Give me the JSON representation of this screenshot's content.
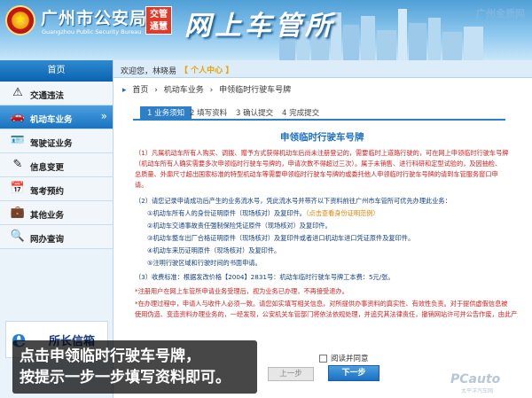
{
  "header": {
    "site_title": "广州市公安局",
    "site_subtitle": "Guangzhou Public Security Bureau",
    "badge": [
      "交管",
      "通慧"
    ],
    "portal_title": "网上车管所",
    "watermark": "广州金质网"
  },
  "topbar": {
    "welcome": "欢迎您，林晓易",
    "personal_center": "【 个人中心 】"
  },
  "sidebar": {
    "home": "首页",
    "items": [
      {
        "label": "交通违法",
        "icon": "warning-icon"
      },
      {
        "label": "机动车业务",
        "icon": "car-icon",
        "active": true
      },
      {
        "label": "驾驶证业务",
        "icon": "license-icon"
      },
      {
        "label": "信息变更",
        "icon": "edit-icon"
      },
      {
        "label": "驾考预约",
        "icon": "calendar-icon"
      },
      {
        "label": "其他业务",
        "icon": "briefcase-icon"
      },
      {
        "label": "网办查询",
        "icon": "search-icon"
      }
    ],
    "mayor_mail": "所长信箱",
    "mayor_e": "e"
  },
  "breadcrumb": [
    "首页",
    "机动车业务",
    "申领临时行驶车号牌"
  ],
  "steps": [
    "1 业务须知",
    "2 填写资料",
    "3 确认提交",
    "4 完成提交"
  ],
  "form_title": "申领临时行驶车号牌",
  "notice": {
    "line1": "（1）凡属机动车所有人购买、调拨、赠予方式获得机动车后尚未注册登记的，需要临时上道路行驶的，可在网上申领临时行驶车号牌",
    "line2": "（机动车所有人确实需要多次申领临时行驶车号牌的，申请次数不得超过三次）。属于未销售、进行科研和定型试验的，及因抽检、",
    "line3": "总质量、外廓尺寸超出国家标准的特型机动车等需要申领临时行驶车号牌的或委托他人申领临时行驶车号牌的请到车管服务窗口申",
    "line4": "请。",
    "line5": "（2）请您记录申请成功后产生的业务流水号，凭此流水号并带齐以下资料前往广州市车管所可优先办理此业务：",
    "item1": "①机动车所有人的身份证明原件（现场核对）及复印件。",
    "item1_link": "（点击查看身份证明范例）",
    "item2": "②机动车交通事故责任强制保险凭证原件（现场核对）及复印件。",
    "item3": "③机动车整车出厂合格证明原件（现场核对）及复印件或者进口机动车进口凭证原件及复印件。",
    "item4": "④机动车来历证明原件（现场核对）及复印件。",
    "item5": "⑤注明行驶区域和行驶时间的书面申请。",
    "fee": "（3）收费标准：根据发改价格【2004】2831号：机动车临时行驶车号牌工本费：5元/张。",
    "warn1": "*注册用户在网上车管所申请业务受理后，视为业务已办理，不再接受退办。",
    "warn2": "*在办理过程中，申请人与收件人必须一致。请您如实填写相关信息，对所提供办事资料的真实性、有效性负责。对于提供虚假信息被",
    "warn3": "使用伪造、变造资料办理业务的，一经发现，公安机关车管部门将依法依规处理，并追究其法律责任，撤销网站许可并公告作废，由此产生的一切法律"
  },
  "agree_label": "阅读并同意",
  "buttons": {
    "prev": "上一步",
    "next": "下一步"
  },
  "caption": [
    "点击申领临时行驶车号牌，",
    "按提示一步一步填写资料即可。"
  ],
  "pcauto": "PCauto",
  "pcauto_sub": "太平洋汽车网"
}
